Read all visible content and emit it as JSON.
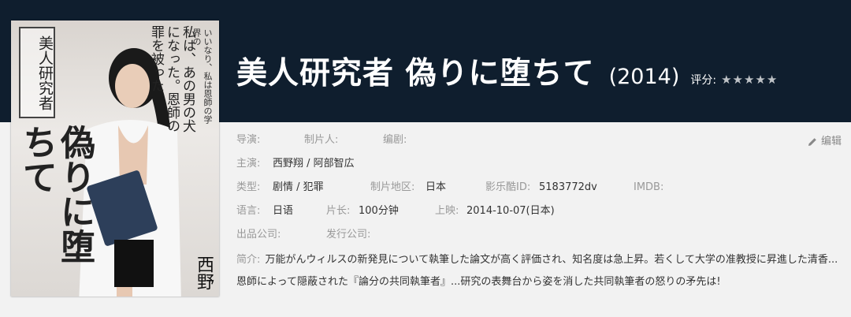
{
  "movie": {
    "title": "美人研究者 偽りに堕ちて",
    "year": "(2014)",
    "rating_label": "评分:",
    "stars": "★★★★★"
  },
  "poster": {
    "title_box": "美人研究者",
    "title_big": "偽りに堕ちて",
    "tagline_a": "いいなり、私は恩師の学界の",
    "tagline_b": "私は、あの男の犬になった。恩師の罪を被った",
    "name": "西野"
  },
  "details": {
    "director_label": "导演:",
    "producer_label": "制片人:",
    "writer_label": "编剧:",
    "edit_label": "编辑",
    "cast_label": "主演:",
    "cast_value": "西野翔 / 阿部智広",
    "genre_label": "类型:",
    "genre_value": "剧情 / 犯罪",
    "region_label": "制片地区:",
    "region_value": "日本",
    "id_label": "影乐酷ID:",
    "id_value": "5183772dv",
    "imdb_label": "IMDB:",
    "language_label": "语言:",
    "language_value": "日语",
    "length_label": "片长:",
    "length_value": "100分钟",
    "release_label": "上映:",
    "release_value": "2014-10-07(日本)",
    "company_label": "出品公司:",
    "distributor_label": "发行公司:",
    "summary_label": "简介:",
    "summary_value": "万能がんウィルスの新発見について執筆した論文が高く評価され、知名度は急上昇。若くして大学の准教授に昇進した清香...恩師によって隠蔽された『論分の共同執筆者』...研究の表舞台から姿を消した共同執筆者の怒りの矛先は!"
  }
}
